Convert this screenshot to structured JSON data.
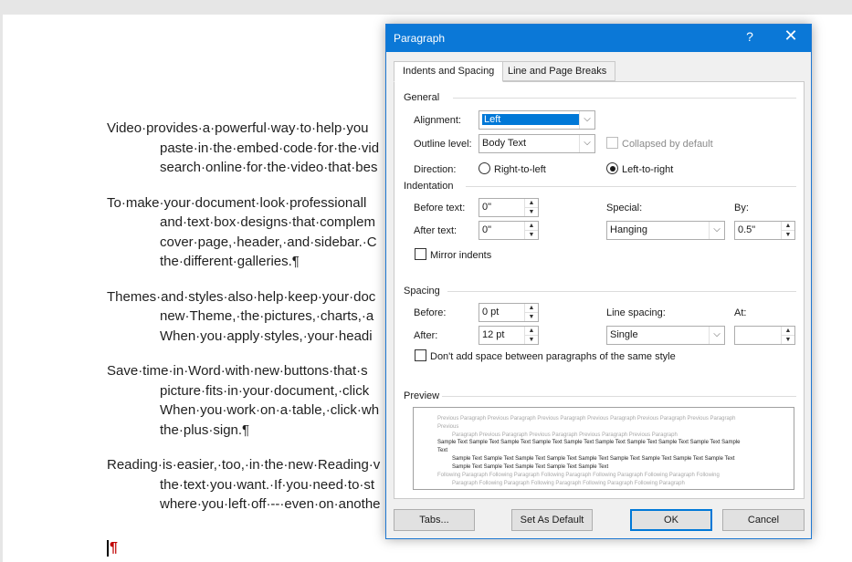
{
  "document": {
    "paragraphs": [
      [
        "Video·provides·a·powerful·way·to·help·you",
        "paste·in·the·embed·code·for·the·vid",
        "search·online·for·the·video·that·bes"
      ],
      [
        "To·make·your·document·look·professionall",
        "and·text·box·designs·that·complem",
        "cover·page,·header,·and·sidebar.·C",
        "the·different·galleries.¶"
      ],
      [
        "Themes·and·styles·also·help·keep·your·doc",
        "new·Theme,·the·pictures,·charts,·a",
        "When·you·apply·styles,·your·headi"
      ],
      [
        "Save·time·in·Word·with·new·buttons·that·s",
        "picture·fits·in·your·document,·click",
        "When·you·work·on·a·table,·click·wh",
        "the·plus·sign.¶"
      ],
      [
        "Reading·is·easier,·too,·in·the·new·Reading·v",
        "the·text·you·want.·If·you·need·to·st",
        "where·you·left·off·--·even·on·anothe"
      ]
    ],
    "empty_para_mark": "¶"
  },
  "dialog": {
    "title": "Paragraph",
    "help": "?",
    "close": "✕",
    "tabs": [
      "Indents and Spacing",
      "Line and Page Breaks"
    ],
    "general": {
      "heading": "General",
      "alignment_label": "Alignment:",
      "alignment_value": "Left",
      "outline_label": "Outline level:",
      "outline_value": "Body Text",
      "collapsed_label": "Collapsed by default",
      "direction_label": "Direction:",
      "rtl_label": "Right-to-left",
      "ltr_label": "Left-to-right"
    },
    "indentation": {
      "heading": "Indentation",
      "before_label": "Before text:",
      "before_value": "0\"",
      "after_label": "After text:",
      "after_value": "0\"",
      "special_label": "Special:",
      "special_value": "Hanging",
      "by_label": "By:",
      "by_value": "0.5\"",
      "mirror_label": "Mirror indents"
    },
    "spacing": {
      "heading": "Spacing",
      "before_label": "Before:",
      "before_value": "0 pt",
      "after_label": "After:",
      "after_value": "12 pt",
      "line_label": "Line spacing:",
      "line_value": "Single",
      "at_label": "At:",
      "at_value": "",
      "dont_add_label": "Don't add space between paragraphs of the same style"
    },
    "preview": {
      "heading": "Preview",
      "previous_1": "Previous Paragraph Previous Paragraph Previous Paragraph Previous Paragraph Previous Paragraph Previous Paragraph Previous",
      "previous_2": "Paragraph Previous Paragraph Previous Paragraph Previous Paragraph Previous Paragraph",
      "sample_1": "Sample Text Sample Text Sample Text Sample Text Sample Text Sample Text Sample Text Sample Text Sample Text Sample Text",
      "sample_2": "Sample Text Sample Text Sample Text Sample Text Sample Text Sample Text Sample Text Sample Text Sample Text",
      "sample_3": "Sample Text Sample Text Sample Text Sample Text Sample Text",
      "following_1": "Following Paragraph Following Paragraph Following Paragraph Following Paragraph Following Paragraph Following",
      "following_2": "Paragraph Following Paragraph Following Paragraph Following Paragraph Following Paragraph"
    },
    "buttons": {
      "tabs": "Tabs...",
      "set_default": "Set As Default",
      "ok": "OK",
      "cancel": "Cancel"
    }
  },
  "colors": {
    "titlebar": "#0b78d7",
    "selection": "#0078d7",
    "para_mark": "#c00000"
  }
}
